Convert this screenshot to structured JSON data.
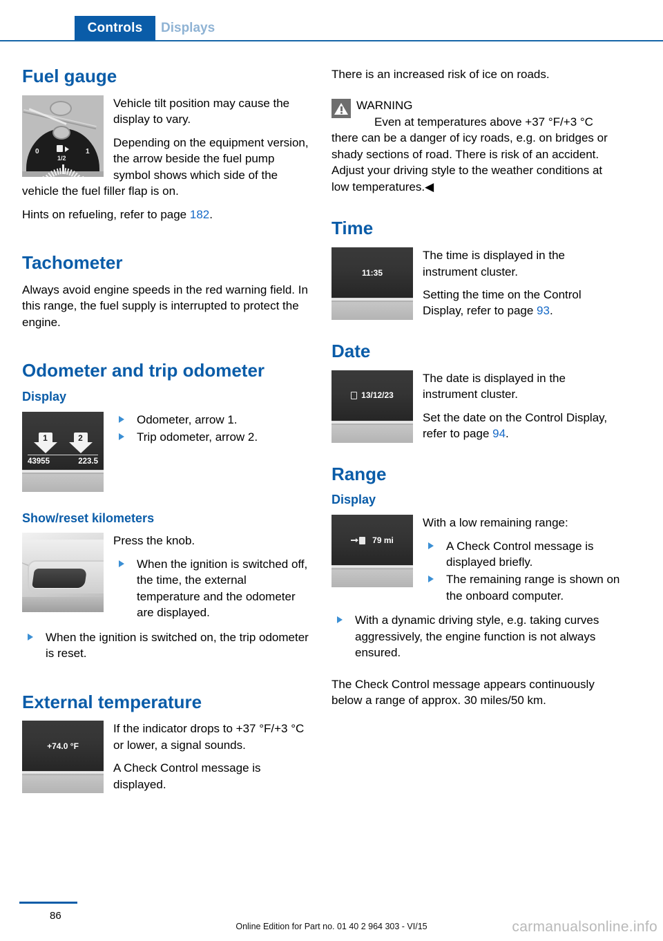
{
  "header": {
    "tab_active": "Controls",
    "tab_inactive": "Displays"
  },
  "left_column": {
    "fuel_gauge": {
      "title": "Fuel gauge",
      "figure": {
        "name": "fuel-gauge-illustration",
        "label_0": "0",
        "label_half": "1/2",
        "label_1": "1"
      },
      "para1": "Vehicle tilt position may cause the display to vary.",
      "para2": "Depending on the equipment version, the arrow beside the fuel pump symbol shows which side of the vehicle the fuel filler flap is on.",
      "para3_pre": "Hints on refueling, refer to page ",
      "para3_page": "182",
      "para3_post": "."
    },
    "tachometer": {
      "title": "Tachometer",
      "para1": "Always avoid engine speeds in the red warning field. In this range, the fuel supply is interrupted to protect the engine."
    },
    "odometer": {
      "title": "Odometer and trip odometer",
      "display_heading": "Display",
      "figure": {
        "arrow1_num": "1",
        "arrow2_num": "2",
        "odometer_value": "43955",
        "trip_value": "223.5"
      },
      "bullets": [
        "Odometer, arrow 1.",
        "Trip odometer, arrow 2."
      ]
    },
    "show_reset": {
      "title": "Show/reset kilometers",
      "para1": "Press the knob.",
      "bullets_indented": [
        "When the ignition is switched off, the time, the external temperature and the odometer are displayed."
      ],
      "bullets_full": [
        "When the ignition is switched on, the trip odometer is reset."
      ]
    },
    "external_temperature": {
      "title": "External temperature",
      "figure_value": "+74.0 °F",
      "para1": "If the indicator drops to +37 °F/+3 °C or lower, a signal sounds.",
      "para2": "A Check Control message is displayed."
    }
  },
  "right_column": {
    "ice_note": "There is an increased risk of ice on roads.",
    "warning": {
      "title": "WARNING",
      "body": "Even at temperatures above +37 °F/+3 °C there can be a danger of icy roads, e.g. on bridges or shady sections of road. There is risk of an accident. Adjust your driving style to the weather conditions at low temperatures.◀"
    },
    "time": {
      "title": "Time",
      "figure_value": "11:35",
      "para1": "The time is displayed in the instrument cluster.",
      "para2_pre": "Setting the time on the Control Display, refer to page ",
      "para2_page": "93",
      "para2_post": "."
    },
    "date": {
      "title": "Date",
      "figure_value": "13/12/23",
      "para1": "The date is displayed in the instrument cluster.",
      "para2_pre": "Set the date on the Control Display, refer to page ",
      "para2_page": "94",
      "para2_post": "."
    },
    "range": {
      "title": "Range",
      "display_heading": "Display",
      "figure_value": "79 mi",
      "intro": "With a low remaining range:",
      "bullets_indented": [
        "A Check Control message is displayed briefly.",
        "The remaining range is shown on the onboard computer."
      ],
      "bullets_full": [
        "With a dynamic driving style, e.g. taking curves aggressively, the engine function is not always ensured."
      ],
      "closing": "The Check Control message appears continuously below a range of approx. 30 miles/50 km."
    }
  },
  "footer": {
    "page_number": "86",
    "edition": "Online Edition for Part no. 01 40 2 964 303 - VI/15",
    "watermark": "carmanualsonline.info"
  },
  "colors": {
    "brand_blue": "#0a5ca8",
    "link_blue": "#1569c7",
    "tab_inactive": "#8fb3d4"
  }
}
